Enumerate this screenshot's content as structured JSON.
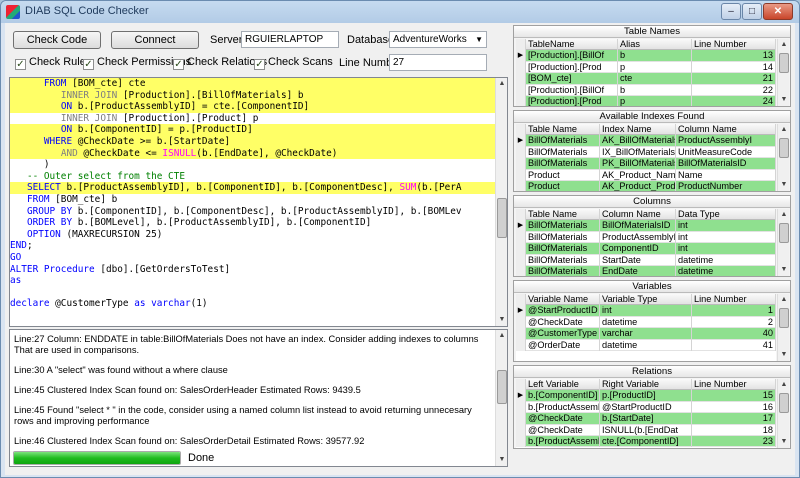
{
  "window": {
    "title": "DIAB SQL Code Checker",
    "min_glyph": "–",
    "max_glyph": "□",
    "close_glyph": "✕"
  },
  "toolbar": {
    "check_code_label": "Check Code",
    "connect_label": "Connect",
    "server_label": "Server",
    "server_value": "RGUIERLAPTOP",
    "database_label": "Database",
    "database_value": "AdventureWorks",
    "line_number_label": "Line Number",
    "line_number_value": "27"
  },
  "checks": [
    {
      "label": "Check Rules",
      "checked": true
    },
    {
      "label": "Check Permissions",
      "checked": true
    },
    {
      "label": "Check Relations",
      "checked": true
    },
    {
      "label": "Check Scans",
      "checked": true
    }
  ],
  "code_lines": [
    {
      "hl": true,
      "html": "      <span class='kw'>FROM</span> [BOM_cte] cte"
    },
    {
      "hl": true,
      "html": "         <span class='gr'>INNER JOIN</span> [Production].[BillOfMaterials] b"
    },
    {
      "hl": true,
      "html": "         <span class='kw'>ON</span> b.[ProductAssemblyID] = cte.[ComponentID]"
    },
    {
      "hl": false,
      "html": "         <span class='gr'>INNER JOIN</span> [Production].[Product] p"
    },
    {
      "hl": true,
      "html": "         <span class='kw'>ON</span> b.[ComponentID] = p.[ProductID]"
    },
    {
      "hl": true,
      "html": "      <span class='kw'>WHERE</span> @CheckDate >= b.[StartDate]"
    },
    {
      "hl": true,
      "html": "         <span class='gr'>AND</span> @CheckDate &lt;= <span class='fn'>ISNULL</span>(b.[EndDate], @CheckDate)"
    },
    {
      "hl": false,
      "html": "      )"
    },
    {
      "hl": false,
      "html": "   <span class='cm'>-- Outer select from the CTE</span>"
    },
    {
      "hl": true,
      "html": "   <span class='kw'>SELECT</span> b.[ProductAssemblyID], b.[ComponentID], b.[ComponentDesc], <span class='fn'>SUM</span>(b.[PerA"
    },
    {
      "hl": false,
      "html": "   <span class='kw'>FROM</span> [BOM_cte] b"
    },
    {
      "hl": false,
      "html": "   <span class='kw'>GROUP BY</span> b.[ComponentID], b.[ComponentDesc], b.[ProductAssemblyID], b.[BOMLev"
    },
    {
      "hl": false,
      "html": "   <span class='kw'>ORDER BY</span> b.[BOMLevel], b.[ProductAssemblyID], b.[ComponentID]"
    },
    {
      "hl": false,
      "html": "   <span class='kw'>OPTION</span> (MAXRECURSION 25)"
    },
    {
      "hl": false,
      "html": "<span class='kw'>END</span>;"
    },
    {
      "hl": false,
      "html": "<span class='kw'>GO</span>"
    },
    {
      "hl": false,
      "html": "<span class='kw'>ALTER Procedure</span> [dbo].[GetOrdersToTest]"
    },
    {
      "hl": false,
      "html": "<span class='kw'>as</span>"
    },
    {
      "hl": false,
      "html": ""
    },
    {
      "hl": false,
      "html": "<span class='kw'>declare</span> @CustomerType <span class='kw'>as varchar</span>(1)"
    }
  ],
  "messages": [
    "Line:27    Column: ENDDATE in table:BillOfMaterials Does not have an index. Consider adding indexes to columns That are used in comparisons.",
    "Line:30    A \"select\" was found without a where clause",
    "Line:45    Clustered Index Scan found on: SalesOrderHeader     Estimated Rows: 9439.5",
    "Line:45    Found \"select * \" in the code, consider using a named column list instead to avoid returning unnecesary rows and improving performance",
    "Line:46    Clustered Index Scan found on: SalesOrderDetail     Estimated Rows: 39577.92"
  ],
  "status": {
    "text": "Done",
    "progress": 1.0
  },
  "panels": {
    "table_names": {
      "title": "Table Names",
      "columns": [
        "TableName",
        "Alias",
        "Line Number"
      ],
      "rows": [
        {
          "cells": [
            "[Production].[BillOf",
            "b",
            "13"
          ],
          "sel": true,
          "current": true
        },
        {
          "cells": [
            "[Production].[Prod",
            "p",
            "14"
          ],
          "sel": false
        },
        {
          "cells": [
            "[BOM_cte]",
            "cte",
            "21"
          ],
          "sel": true
        },
        {
          "cells": [
            "[Production].[BillOf",
            "b",
            "22"
          ],
          "sel": false
        },
        {
          "cells": [
            "[Production].[Prod",
            "p",
            "24"
          ],
          "sel": true
        }
      ]
    },
    "indexes": {
      "title": "Available Indexes Found",
      "columns": [
        "Table Name",
        "Index Name",
        "Column Name"
      ],
      "rows": [
        {
          "cells": [
            "BillOfMaterials",
            "AK_BillOfMaterials",
            "ProductAssemblyI"
          ],
          "sel": true,
          "current": true
        },
        {
          "cells": [
            "BillOfMaterials",
            "IX_BillOfMaterials",
            "UnitMeasureCode"
          ],
          "sel": false
        },
        {
          "cells": [
            "BillOfMaterials",
            "PK_BillOfMaterials",
            "BillOfMaterialsID"
          ],
          "sel": true
        },
        {
          "cells": [
            "Product",
            "AK_Product_Nam",
            "Name"
          ],
          "sel": false
        },
        {
          "cells": [
            "Product",
            "AK_Product_Prod",
            "ProductNumber"
          ],
          "sel": true
        }
      ]
    },
    "columns": {
      "title": "Columns",
      "columns": [
        "Table Name",
        "Column Name",
        "Data Type"
      ],
      "rows": [
        {
          "cells": [
            "BillOfMaterials",
            "BillOfMaterialsID",
            "int"
          ],
          "sel": true,
          "current": true
        },
        {
          "cells": [
            "BillOfMaterials",
            "ProductAssemblyI",
            "int"
          ],
          "sel": false
        },
        {
          "cells": [
            "BillOfMaterials",
            "ComponentID",
            "int"
          ],
          "sel": true
        },
        {
          "cells": [
            "BillOfMaterials",
            "StartDate",
            "datetime"
          ],
          "sel": false
        },
        {
          "cells": [
            "BillOfMaterials",
            "EndDate",
            "datetime"
          ],
          "sel": true
        }
      ]
    },
    "variables": {
      "title": "Variables",
      "columns": [
        "Variable Name",
        "Variable Type",
        "Line Number"
      ],
      "rows": [
        {
          "cells": [
            "@StartProductID",
            "int",
            "1"
          ],
          "sel": true,
          "current": true
        },
        {
          "cells": [
            "@CheckDate",
            "datetime",
            "2"
          ],
          "sel": false
        },
        {
          "cells": [
            "@CustomerType",
            "varchar",
            "40"
          ],
          "sel": true
        },
        {
          "cells": [
            "@OrderDate",
            "datetime",
            "41"
          ],
          "sel": false
        }
      ]
    },
    "relations": {
      "title": "Relations",
      "columns": [
        "Left Variable",
        "Right Variable",
        "Line Number"
      ],
      "rows": [
        {
          "cells": [
            "b.[ComponentID]",
            "p.[ProductID]",
            "15"
          ],
          "sel": true,
          "current": true
        },
        {
          "cells": [
            "b.[ProductAssembl",
            "@StartProductID",
            "16"
          ],
          "sel": false
        },
        {
          "cells": [
            "@CheckDate",
            "b.[StartDate]",
            "17"
          ],
          "sel": true
        },
        {
          "cells": [
            "@CheckDate",
            "ISNULL(b.[EndDat",
            "18"
          ],
          "sel": false
        },
        {
          "cells": [
            "b.[ProductAssembl",
            "cte.[ComponentID]",
            "23"
          ],
          "sel": true
        }
      ]
    }
  },
  "icons": {
    "app": "sql-checker-app-icon",
    "row_pointer": "▶",
    "scroll_up": "▲",
    "scroll_down": "▼",
    "combo_arrow": "▼",
    "check_glyph": "✓"
  },
  "colors": {
    "selected_row": "#8fe08f",
    "highlight_line": "#ffff66",
    "progress": "#1fbc1f"
  }
}
